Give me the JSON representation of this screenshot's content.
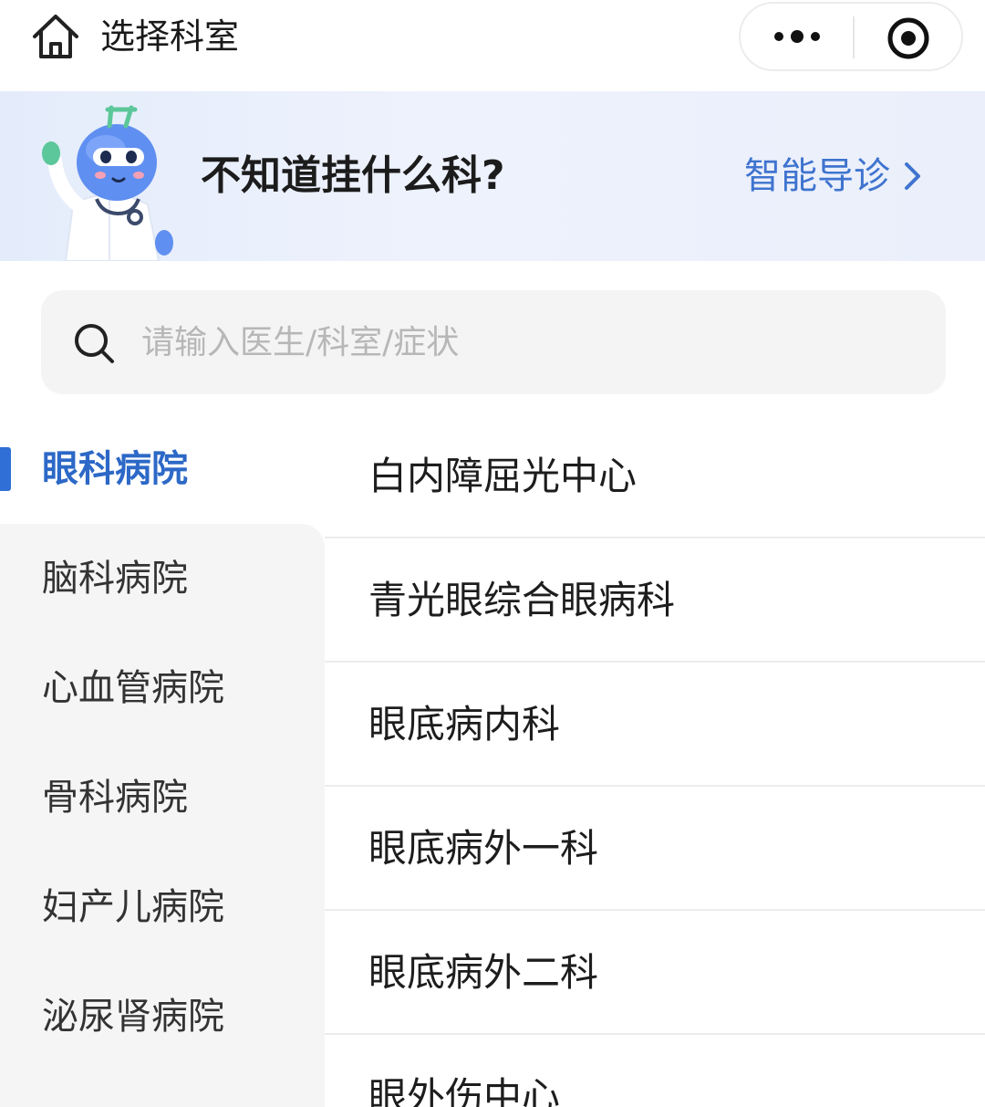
{
  "header": {
    "title": "选择科室",
    "home_icon": "home-icon",
    "more_icon": "more-dots-icon",
    "close_icon": "target-close-icon"
  },
  "banner": {
    "question": "不知道挂什么科?",
    "link_label": "智能导诊",
    "link_icon": "chevron-right-icon",
    "link_color": "#3f74cf",
    "mascot": "doctor-robot-mascot"
  },
  "search": {
    "placeholder": "请输入医生/科室/症状",
    "value": ""
  },
  "categories": [
    {
      "label": "眼科病院",
      "active": true
    },
    {
      "label": "脑科病院",
      "active": false
    },
    {
      "label": "心血管病院",
      "active": false
    },
    {
      "label": "骨科病院",
      "active": false
    },
    {
      "label": "妇产儿病院",
      "active": false
    },
    {
      "label": "泌尿肾病院",
      "active": false
    }
  ],
  "departments": [
    {
      "label": "白内障屈光中心"
    },
    {
      "label": "青光眼综合眼病科"
    },
    {
      "label": "眼底病内科"
    },
    {
      "label": "眼底病外一科"
    },
    {
      "label": "眼底病外二科"
    },
    {
      "label": "眼外伤中心"
    }
  ],
  "colors": {
    "accent": "#2c68c7",
    "banner_bg": "#e8eefb",
    "sidebar_bg": "#f5f5f5"
  }
}
